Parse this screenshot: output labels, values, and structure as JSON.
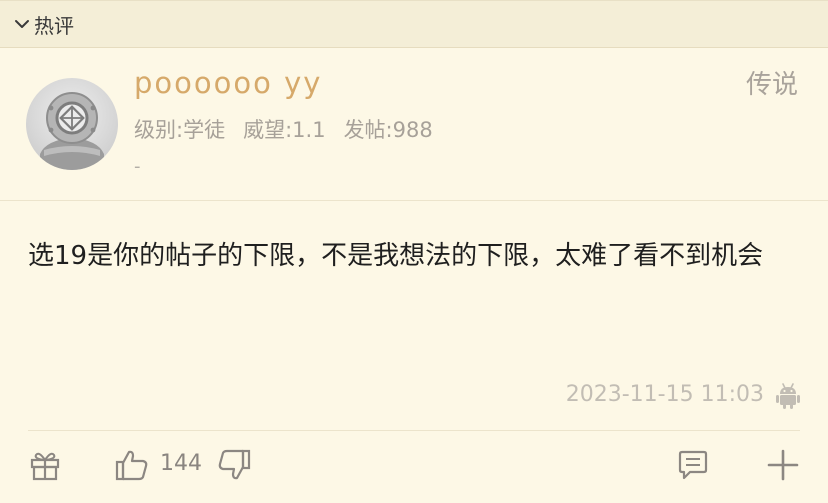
{
  "section": {
    "title": "热评"
  },
  "user": {
    "name": "poooooo yy",
    "level_label": "级别:学徒",
    "prestige_label": "威望:1.1",
    "posts_label": "发帖:988",
    "signature": "-",
    "rank": "传说"
  },
  "post": {
    "body": "选19是你的帖子的下限，不是我想法的下限，太难了看不到机会",
    "timestamp": "2023-11-15 11:03"
  },
  "actions": {
    "like_count": "144"
  },
  "colors": {
    "background": "#fdf8e6",
    "header": "#f4eed7",
    "username": "#d6a96a",
    "muted": "#a7a199",
    "icon": "#8c8782"
  }
}
